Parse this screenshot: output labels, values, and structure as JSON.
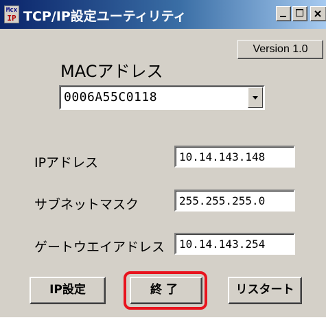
{
  "window": {
    "title": "TCP/IP設定ユーティリティ",
    "icon_text_top": "Mcx",
    "icon_text_bottom": "IP"
  },
  "version_button": {
    "label": "Version 1.0"
  },
  "mac": {
    "label": "MACアドレス",
    "selected": "0006A55C0118"
  },
  "ip_address": {
    "label": "IPアドレス",
    "value": "10.14.143.148"
  },
  "subnet_mask": {
    "label": "サブネットマスク",
    "value": "255.255.255.0"
  },
  "gateway": {
    "label": "ゲートウエイアドレス",
    "value": "10.14.143.254"
  },
  "buttons": {
    "ip_settings": "IP設定",
    "exit": "終了",
    "restart": "リスタート"
  },
  "colors": {
    "highlight": "#e8141e",
    "titlebar_start": "#0a246a",
    "titlebar_end": "#a6caf0",
    "face": "#d4d0c8"
  }
}
